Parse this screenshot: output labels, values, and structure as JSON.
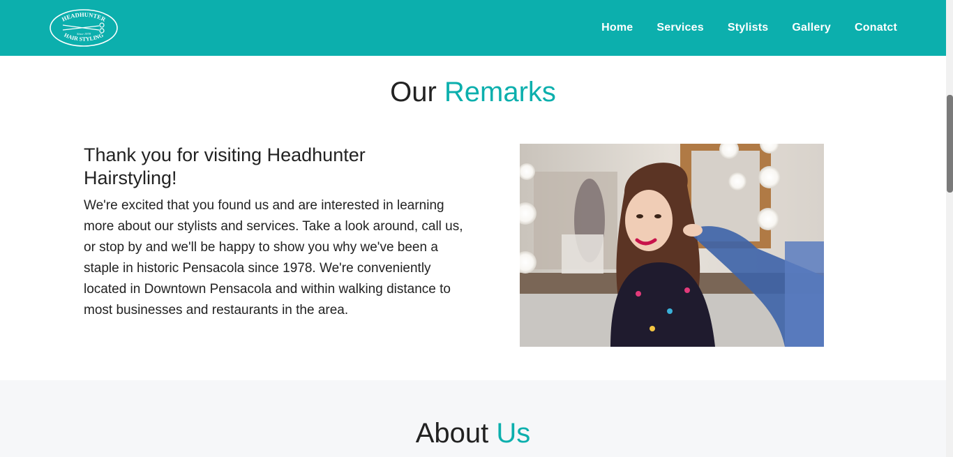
{
  "header": {
    "logo": {
      "top_text": "HEADHUNTER",
      "bottom_text": "HAIR STYLING",
      "since_text": "Since 1978",
      "icon": "scissors-icon"
    },
    "nav": [
      {
        "label": "Home"
      },
      {
        "label": "Services"
      },
      {
        "label": "Stylists"
      },
      {
        "label": "Gallery"
      },
      {
        "label": "Conatct"
      }
    ]
  },
  "remarks": {
    "title_plain": "Our",
    "title_accent": "Remarks",
    "heading": "Thank you for visiting Headhunter Hairstyling!",
    "body": "We're excited that you found us and are interested in learning more about our stylists and services. Take a look around, call us, or stop by and we'll be happy to show you why we've been a staple in historic Pensacola since 1978. We're conveniently located in Downtown Pensacola and within walking distance to most businesses and restaurants in the area.",
    "image_label": "salon-photo"
  },
  "about": {
    "title_plain": "About",
    "title_accent": "Us"
  },
  "colors": {
    "accent": "#0cafad",
    "text": "#222222",
    "about_bg": "#f6f7f9"
  }
}
